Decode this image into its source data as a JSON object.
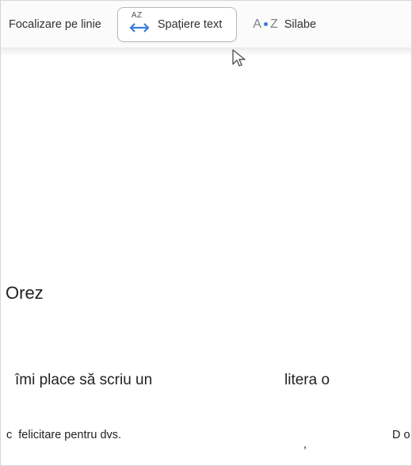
{
  "toolbar": {
    "line_focus_label": "Focalizare pe linie",
    "text_spacing_label": "Spațiere text",
    "syllables_label": "Silabe"
  },
  "content": {
    "title": "Orez",
    "line1_left": "îmi place să scriu un",
    "line1_right": "litera o",
    "line2_prefix": "c",
    "line2_left": "felicitare pentru dvs.",
    "line2_mid": ",",
    "line2_right": "D o"
  }
}
